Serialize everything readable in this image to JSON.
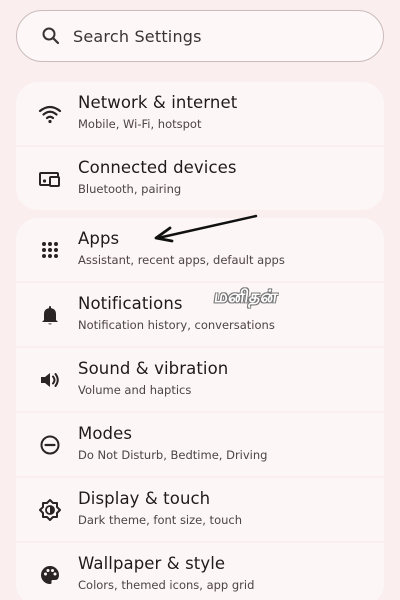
{
  "search": {
    "placeholder": "Search Settings",
    "icon": "search-icon"
  },
  "groups": [
    {
      "items": [
        {
          "title": "Network & internet",
          "subtitle": "Mobile, Wi-Fi, hotspot",
          "icon": "wifi-icon"
        },
        {
          "title": "Connected devices",
          "subtitle": "Bluetooth, pairing",
          "icon": "connected-devices-icon"
        }
      ]
    },
    {
      "items": [
        {
          "title": "Apps",
          "subtitle": "Assistant, recent apps, default apps",
          "icon": "apps-grid-icon"
        },
        {
          "title": "Notifications",
          "subtitle": "Notification history, conversations",
          "icon": "bell-icon"
        },
        {
          "title": "Sound & vibration",
          "subtitle": "Volume and haptics",
          "icon": "volume-icon"
        },
        {
          "title": "Modes",
          "subtitle": "Do Not Disturb, Bedtime, Driving",
          "icon": "do-not-disturb-icon"
        },
        {
          "title": "Display & touch",
          "subtitle": "Dark theme, font size, touch",
          "icon": "display-brightness-icon"
        },
        {
          "title": "Wallpaper & style",
          "subtitle": "Colors, themed icons, app grid",
          "icon": "palette-icon"
        }
      ]
    }
  ],
  "watermark": "மனிதன்",
  "colors": {
    "background": "#fbeeee",
    "card": "#fdf6f6",
    "text": "#1f1b1b",
    "subtext": "#4d4444"
  }
}
